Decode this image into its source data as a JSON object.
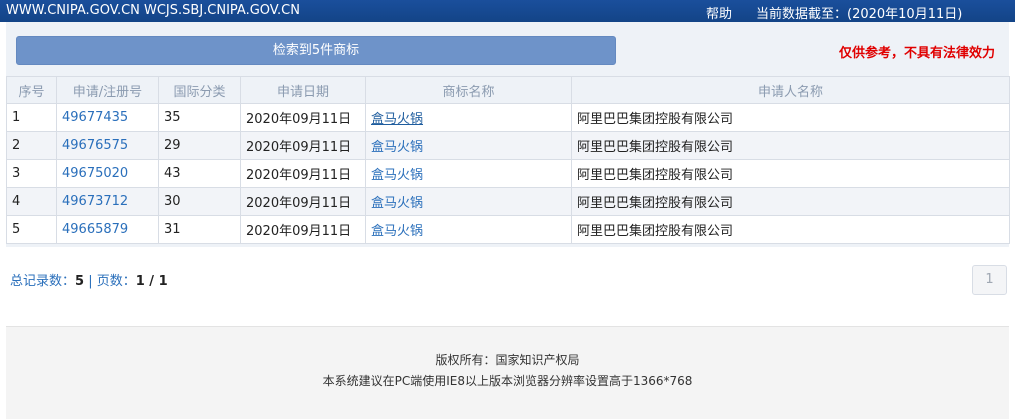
{
  "topbar": {
    "sites": "WWW.CNIPA.GOV.CN WCJS.SBJ.CNIPA.GOV.CN",
    "help": "帮助",
    "data_date": "当前数据截至：(2020年10月11日)"
  },
  "result_button": "检索到5件商标",
  "disclaimer": "仅供参考，不具有法律效力",
  "table": {
    "headers": [
      "序号",
      "申请/注册号",
      "国际分类",
      "申请日期",
      "商标名称",
      "申请人名称"
    ],
    "rows": [
      [
        "1",
        "49677435",
        "35",
        "2020年09月11日",
        "盒马火锅",
        "阿里巴巴集团控股有限公司"
      ],
      [
        "2",
        "49676575",
        "29",
        "2020年09月11日",
        "盒马火锅",
        "阿里巴巴集团控股有限公司"
      ],
      [
        "3",
        "49675020",
        "43",
        "2020年09月11日",
        "盒马火锅",
        "阿里巴巴集团控股有限公司"
      ],
      [
        "4",
        "49673712",
        "30",
        "2020年09月11日",
        "盒马火锅",
        "阿里巴巴集团控股有限公司"
      ],
      [
        "5",
        "49665879",
        "31",
        "2020年09月11日",
        "盒马火锅",
        "阿里巴巴集团控股有限公司"
      ]
    ]
  },
  "summary": {
    "total_label": "总记录数：",
    "total": "5",
    "separator": " | ",
    "pages_label": "页数：",
    "pages": "1 / 1"
  },
  "pager": {
    "current": "1"
  },
  "footer": {
    "copyright": "版权所有：国家知识产权局",
    "suggestion": "本系统建议在PC端使用IE8以上版本浏览器分辨率设置高于1366*768"
  }
}
